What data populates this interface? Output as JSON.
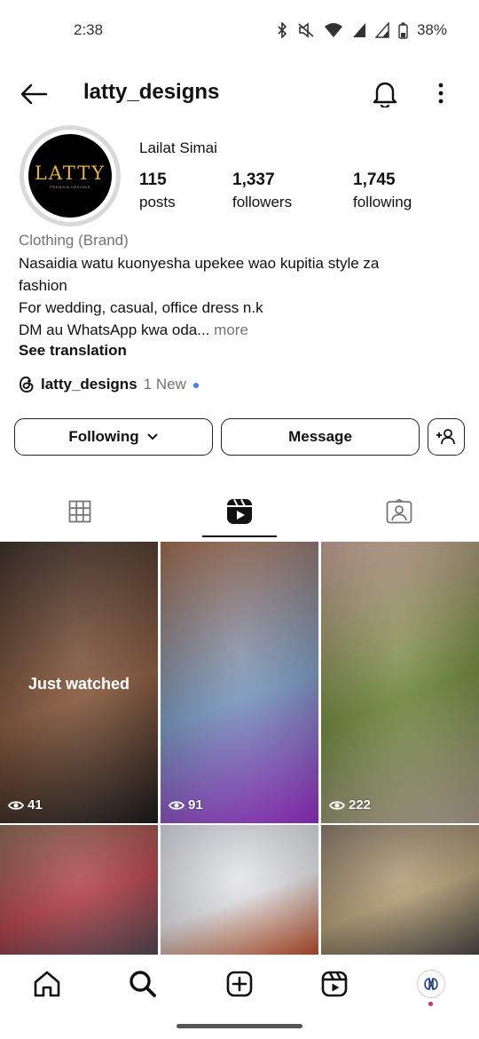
{
  "status_bar": {
    "time": "2:38",
    "battery": "38%",
    "icons": [
      "bluetooth-icon",
      "mute-icon",
      "wifi-icon",
      "signal-icon",
      "signal-icon",
      "battery-icon"
    ]
  },
  "header": {
    "username": "latty_designs"
  },
  "profile": {
    "avatar_text": "LATTY",
    "avatar_subtext": "PREMIUM DESIGNS",
    "full_name": "Lailat Simai",
    "stats": [
      {
        "value": "115",
        "label": "posts"
      },
      {
        "value": "1,337",
        "label": "followers"
      },
      {
        "value": "1,745",
        "label": "following"
      }
    ],
    "category": "Clothing (Brand)",
    "bio_lines": [
      "Nasaidia watu kuonyesha upekee wao kupitia style za",
      "fashion",
      "For wedding, casual, office dress n.k",
      "DM au WhatsApp kwa oda..."
    ],
    "more_label": " more",
    "see_translation": "See translation",
    "threads_name": "latty_designs",
    "threads_new": "1 New"
  },
  "actions": {
    "following_label": "Following",
    "message_label": "Message"
  },
  "tabs": [
    {
      "name": "tab-posts",
      "icon": "grid-icon"
    },
    {
      "name": "tab-reels",
      "icon": "reels-icon",
      "active": true
    },
    {
      "name": "tab-tagged",
      "icon": "tagged-icon"
    }
  ],
  "reels": [
    {
      "views": "41",
      "overlay": "Just watched",
      "colors": [
        "#3a2d26",
        "#8a5a3c",
        "#1c1b1d"
      ]
    },
    {
      "views": "91",
      "colors": [
        "#a06a4a",
        "#7a9cc4",
        "#a22fd4"
      ]
    },
    {
      "views": "222",
      "colors": [
        "#c8a39a",
        "#6f8a3a",
        "#b9a79a"
      ]
    },
    {
      "colors": [
        "#8c6a55",
        "#b8424a",
        "#5a4a55"
      ]
    },
    {
      "colors": [
        "#d7dbe2",
        "#e7e7ea",
        "#c8542c"
      ]
    },
    {
      "colors": [
        "#8a7a6a",
        "#b9a378",
        "#4f4a48"
      ]
    }
  ],
  "bottom_nav": [
    "home-icon",
    "search-icon",
    "create-icon",
    "reels-icon",
    "profile-avatar"
  ]
}
